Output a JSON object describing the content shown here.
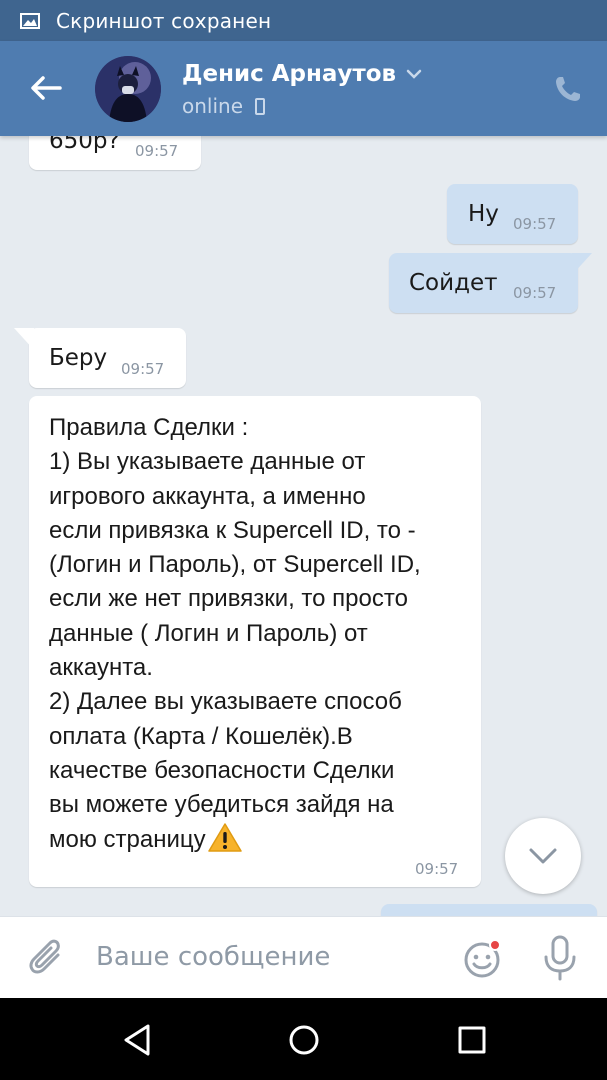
{
  "status_bar": {
    "notification_text": "Скриншот сохранен"
  },
  "header": {
    "contact_name": "Денис Арнаутов",
    "presence": "online"
  },
  "messages": [
    {
      "direction": "in",
      "text": "650р?",
      "time": "09:57"
    },
    {
      "direction": "out",
      "text": "Ну",
      "time": "09:57"
    },
    {
      "direction": "out",
      "text": "Сойдет",
      "time": "09:57"
    },
    {
      "direction": "in",
      "text": "Беру",
      "time": "09:57"
    },
    {
      "direction": "in",
      "text": "Правила Сделки :\n1) Вы указываете данные от\nигрового аккаунта, а именно\nесли привязка к Supercell ID, то -\n(Логин и Пароль), от Supercell ID,\nесли же нет привязки, то просто\nданные ( Логин и Пароль) от\nаккаунта.\n2) Далее вы указываете способ\nоплата (Карта / Кошелёк).В\nкачестве безопасности Сделки\nвы можете убедиться зайдя на\nмою страницу",
      "time": "09:57",
      "emoji": "warning"
    }
  ],
  "composer": {
    "placeholder": "Ваше сообщение"
  },
  "colors": {
    "header": "#4f7cb0",
    "status_bar": "#3f658f",
    "chat_background": "#e6ebf0",
    "outgoing_bubble": "#cddff2",
    "incoming_bubble": "#ffffff",
    "notification_dot": "#e64646"
  },
  "icons": {
    "status_bar": "image-icon",
    "back": "arrow-left-icon",
    "name_menu": "chevron-down-icon",
    "presence_device": "mobile-phone-icon",
    "call": "phone-icon",
    "scroll_down": "chevron-down-icon",
    "attach": "paperclip-icon",
    "emoji": "smiley-icon",
    "mic": "microphone-icon",
    "nav_back": "triangle-back-icon",
    "nav_home": "circle-home-icon",
    "nav_recent": "square-recents-icon"
  }
}
